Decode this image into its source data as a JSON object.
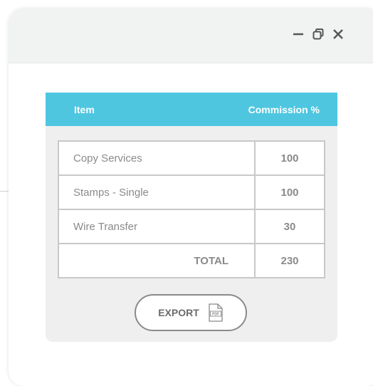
{
  "window": {
    "controls": {
      "minimize_icon": "minimize-icon",
      "restore_icon": "restore-icon",
      "close_icon": "close-icon"
    }
  },
  "table": {
    "header": {
      "item": "Item",
      "commission": "Commission %"
    },
    "rows": [
      {
        "item": "Copy Services",
        "commission": "100"
      },
      {
        "item": "Stamps - Single",
        "commission": "100"
      },
      {
        "item": "Wire Transfer",
        "commission": "30"
      }
    ],
    "total": {
      "label": "TOTAL",
      "value": "230"
    }
  },
  "export": {
    "label": "EXPORT",
    "icon": "pdf-icon",
    "icon_text": "PDF"
  },
  "colors": {
    "header_bg": "#4fc6e0",
    "titlebar_bg": "#f1f2f2",
    "card_bg": "#efefef",
    "border": "#c8c8c8"
  }
}
